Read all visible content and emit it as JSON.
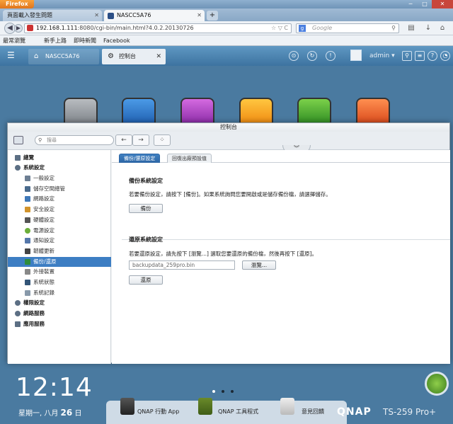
{
  "browser": {
    "app_button": "Firefox",
    "tabs": [
      {
        "label": "頁面載入發生問題"
      },
      {
        "label": "NASCC5A76"
      }
    ],
    "new_tab": "+",
    "url_host": "192.168.1.111",
    "url_path": ":8080/cgi-bin/main.html?4.0.2.20130726",
    "search_placeholder": "Google",
    "bookmarks": [
      "最常瀏覽",
      "新手上路",
      "即時新聞",
      "Facebook"
    ]
  },
  "qnap_toolbar": {
    "home_tab": "NASCC5A76",
    "control_tab": "控制台",
    "user": "admin"
  },
  "window": {
    "title": "控制台",
    "search_placeholder": "搜尋"
  },
  "sidebar": {
    "items": [
      {
        "label": "總覽",
        "level": "top",
        "color": "#5c6f84"
      },
      {
        "label": "系統設定",
        "level": "top",
        "color": "#5c6f84"
      },
      {
        "label": "一般設定",
        "level": "sub",
        "color": "#6d7f93"
      },
      {
        "label": "儲存空間總管",
        "level": "sub",
        "color": "#4a6a8c"
      },
      {
        "label": "網路設定",
        "level": "sub",
        "color": "#3f78b8"
      },
      {
        "label": "安全設定",
        "level": "sub",
        "color": "#d1932b"
      },
      {
        "label": "硬體設定",
        "level": "sub",
        "color": "#555555"
      },
      {
        "label": "電源設定",
        "level": "sub",
        "color": "#6cae3a"
      },
      {
        "label": "通知設定",
        "level": "sub",
        "color": "#5577aa"
      },
      {
        "label": "韌體更新",
        "level": "sub",
        "color": "#444444"
      },
      {
        "label": "備份/還原",
        "level": "sub",
        "color": "#2e8c3c",
        "selected": true
      },
      {
        "label": "外接裝置",
        "level": "sub",
        "color": "#888888"
      },
      {
        "label": "系統狀態",
        "level": "sub",
        "color": "#335577"
      },
      {
        "label": "系統記錄",
        "level": "sub",
        "color": "#8899aa"
      },
      {
        "label": "權限設定",
        "level": "top",
        "color": "#5c6f84"
      },
      {
        "label": "網路服務",
        "level": "top",
        "color": "#5c6f84"
      },
      {
        "label": "應用服務",
        "level": "top",
        "color": "#5c6f84"
      }
    ]
  },
  "content": {
    "tabs": [
      "備份/還原設定",
      "回復出廠預設值"
    ],
    "backup_title": "備份系統設定",
    "backup_desc": "若要備份設定，請按下 [備份]。如果系統詢問您要開啟或是儲存備份檔，請選擇儲存。",
    "backup_button": "備份",
    "restore_title": "還原系統設定",
    "restore_desc": "若要還原設定，請先按下 [瀏覽...] 選取您要還原的備份檔，然後再按下 [還原]。",
    "file_value": "backupdata_259pro.bin",
    "browse_button": "瀏覽...",
    "restore_button": "還原"
  },
  "desktop": {
    "time": "12:14",
    "date_prefix": "星期一, 八月",
    "date_day": "26",
    "date_suffix": "日",
    "dock": [
      "QNAP 行動 App",
      "QNAP 工具程式",
      "意見回饋"
    ],
    "brand": "QNAP",
    "model": "TS-259 Pro+"
  },
  "colors": {
    "accent": "#3d7ec3",
    "toolbar": "#4a82b0"
  }
}
